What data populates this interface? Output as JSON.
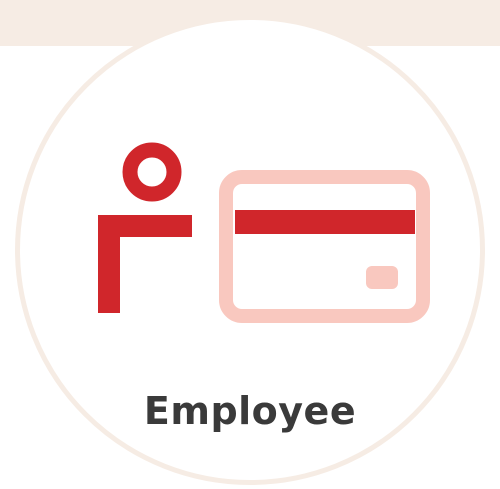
{
  "label": "Employee",
  "icons": {
    "person": "person-icon",
    "card": "id-card-icon"
  },
  "colors": {
    "background": "#ffffff",
    "ring": "#f6ece4",
    "person": "#d0262b",
    "card_outline": "#f9c8bf",
    "card_stripe": "#d0262b",
    "text": "#3a3a3a"
  }
}
